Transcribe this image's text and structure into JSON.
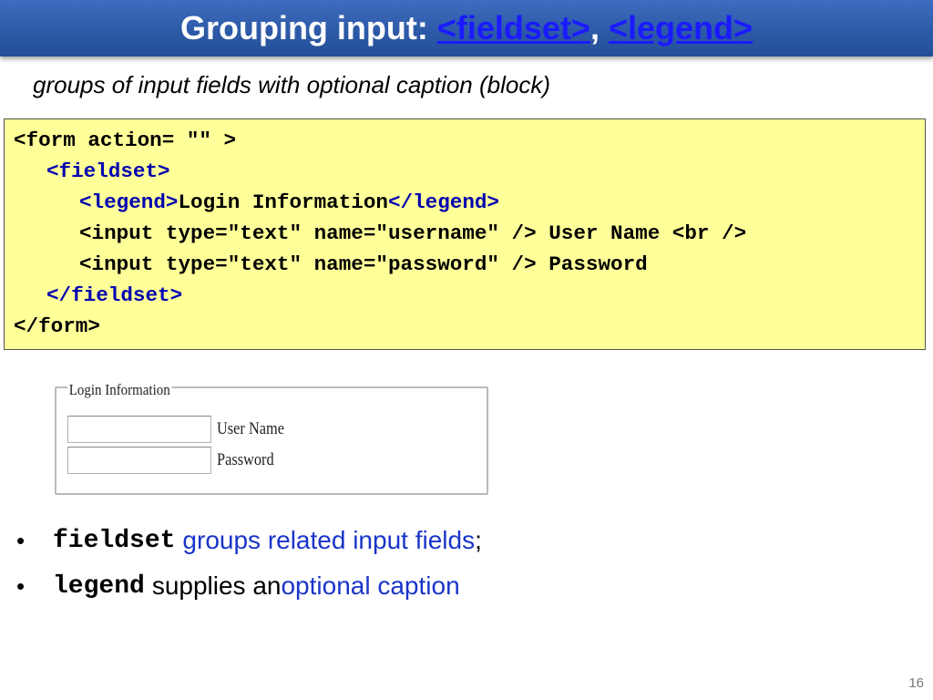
{
  "slide": {
    "title_prefix": "Grouping input: ",
    "title_tag1": "<fieldset>",
    "title_sep": ", ",
    "title_tag2": "<legend>",
    "subtitle": "groups of input fields with optional caption (block)",
    "page_number": "16"
  },
  "code": {
    "l1": "<form action= \"\" >",
    "l2": "<fieldset>",
    "l3_open": "<legend>",
    "l3_text": "Login Information",
    "l3_close": "</legend>",
    "l4": "<input type=\"text\" name=\"username\" /> User Name <br />",
    "l5": "<input type=\"text\" name=\"password\" /> Password",
    "l6": "</fieldset>",
    "l7": "</form>"
  },
  "demo": {
    "legend": "Login Information",
    "username_label": "User Name",
    "password_label": "Password"
  },
  "bullets": [
    {
      "keyword": "fieldset",
      "text_blue": "groups related input fields",
      "text_end": ";"
    },
    {
      "keyword": "legend",
      "text_plain": "supplies an ",
      "text_blue": "optional caption"
    }
  ],
  "colors": {
    "title_bar": "#2d5aa8",
    "code_bg": "#ffff99",
    "link_blue": "#1a35c9"
  }
}
